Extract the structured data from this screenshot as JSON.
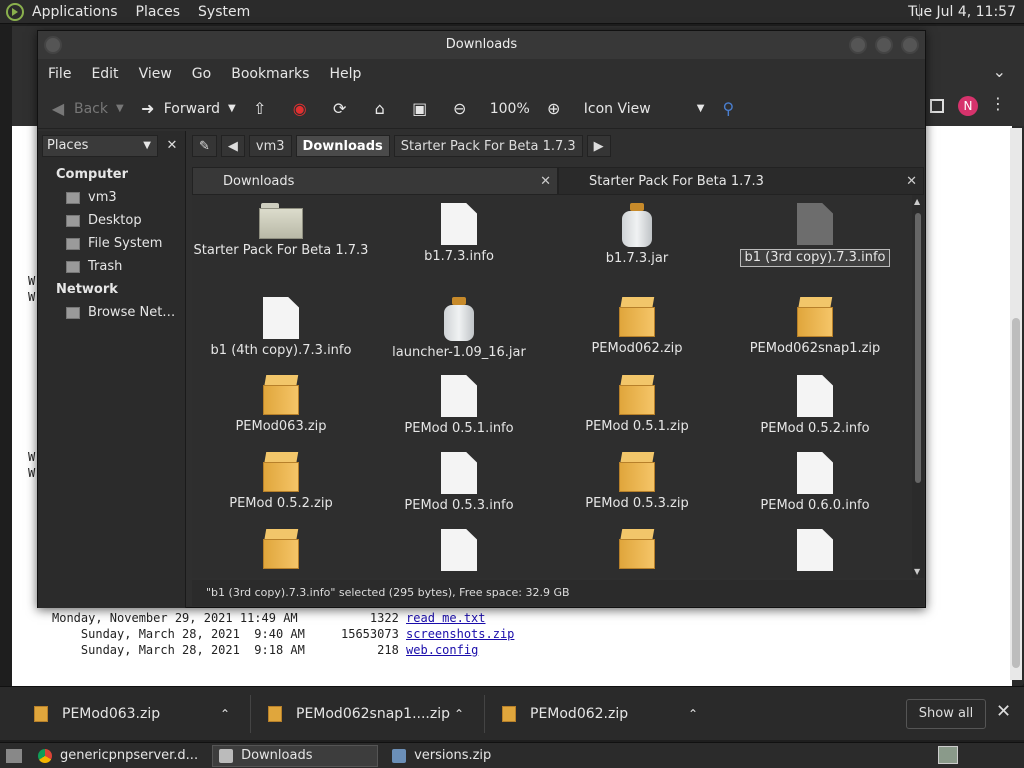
{
  "topbar": {
    "menus": [
      "Applications",
      "Places",
      "System"
    ],
    "clock": "Tue Jul  4, 11:57"
  },
  "browser": {
    "avatar_letter": "N",
    "w_marks": [
      "W",
      "W",
      "W",
      "W"
    ],
    "listing": [
      {
        "date": "Monday, November 29, 2021 11:49 AM",
        "size": "1322",
        "name": "read me.txt"
      },
      {
        "date": "Sunday, March 28, 2021  9:40 AM",
        "size": "15653073",
        "name": "screenshots.zip"
      },
      {
        "date": "Sunday, March 28, 2021  9:18 AM",
        "size": "218",
        "name": "web.config"
      }
    ]
  },
  "window": {
    "title": "Downloads",
    "menubar": [
      "File",
      "Edit",
      "View",
      "Go",
      "Bookmarks",
      "Help"
    ],
    "toolbar": {
      "back": "Back",
      "forward": "Forward",
      "zoom": "100%",
      "view_mode": "Icon View"
    },
    "sidebar": {
      "selector": "Places",
      "sections": [
        {
          "title": "Computer",
          "items": [
            "vm3",
            "Desktop",
            "File System",
            "Trash"
          ]
        },
        {
          "title": "Network",
          "items": [
            "Browse Net…"
          ]
        }
      ]
    },
    "pathbar": [
      "vm3",
      "Downloads",
      "Starter Pack For Beta 1.7.3"
    ],
    "tabs": [
      "Downloads",
      "Starter Pack For Beta 1.7.3"
    ],
    "files": [
      {
        "name": "Starter Pack For Beta 1.7.3",
        "type": "folder"
      },
      {
        "name": "b1.7.3.info",
        "type": "doc"
      },
      {
        "name": "b1.7.3.jar",
        "type": "jar"
      },
      {
        "name": "b1 (3rd copy).7.3.info",
        "type": "doc-gray",
        "selected": true
      },
      {
        "name": "b1 (4th copy).7.3.info",
        "type": "doc"
      },
      {
        "name": "launcher-1.09_16.jar",
        "type": "jar"
      },
      {
        "name": "PEMod062.zip",
        "type": "pkg"
      },
      {
        "name": "PEMod062snap1.zip",
        "type": "pkg"
      },
      {
        "name": "PEMod063.zip",
        "type": "pkg"
      },
      {
        "name": "PEMod 0.5.1.info",
        "type": "doc"
      },
      {
        "name": "PEMod 0.5.1.zip",
        "type": "pkg"
      },
      {
        "name": "PEMod 0.5.2.info",
        "type": "doc"
      },
      {
        "name": "PEMod 0.5.2.zip",
        "type": "pkg"
      },
      {
        "name": "PEMod 0.5.3.info",
        "type": "doc"
      },
      {
        "name": "PEMod 0.5.3.zip",
        "type": "pkg"
      },
      {
        "name": "PEMod 0.6.0.info",
        "type": "doc"
      },
      {
        "name": "",
        "type": "pkg"
      },
      {
        "name": "",
        "type": "doc"
      },
      {
        "name": "",
        "type": "pkg"
      },
      {
        "name": "",
        "type": "doc"
      }
    ],
    "status": "\"b1 (3rd copy).7.3.info\" selected (295 bytes), Free space: 32.9 GB"
  },
  "downloads_shelf": {
    "items": [
      "PEMod063.zip",
      "PEMod062snap1....zip",
      "PEMod062.zip"
    ],
    "show_all": "Show all"
  },
  "taskbar": {
    "tasks": [
      "genericpnpserver.d...",
      "Downloads",
      "versions.zip"
    ]
  },
  "colors": {
    "window_bg": "#2f2f2f",
    "stop_red": "#e03030",
    "avatar": "#d6336c",
    "folder_pkg": "#e0a63c"
  }
}
